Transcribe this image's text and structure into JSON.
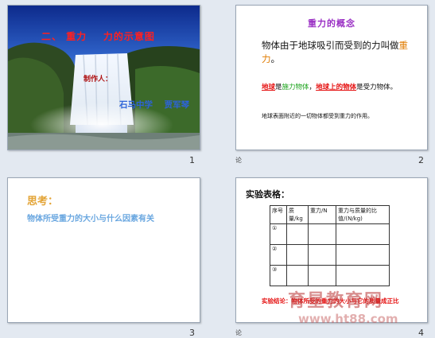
{
  "slides": [
    {
      "number": "1",
      "title": "二、 重力    力的示意图",
      "subtitle": "制作人：",
      "author": "石马中学    贾军琴"
    },
    {
      "number": "2",
      "title": "重力的概念",
      "definition_prefix": "物体由于地球吸引而受到的力叫做",
      "definition_highlight": "重力",
      "definition_suffix": "。",
      "relation_part1": "地球",
      "relation_part2": "是",
      "relation_part3": "施力物体",
      "relation_part4": "，",
      "relation_part5": "地球上的物体",
      "relation_part6": "是受力物体。",
      "note": "地球表面附近的一切物体都受到重力的作用。",
      "footer": "论"
    },
    {
      "number": "3",
      "think": "思考：",
      "question": "物体所受重力的大小与什么因素有关"
    },
    {
      "number": "4",
      "heading": "实验表格：",
      "table_headers": [
        "序号",
        "质量/kg",
        "重力/N",
        "重力与质量的比值/(N/kg)"
      ],
      "table_rows": [
        "①",
        "②",
        "③"
      ],
      "conclusion": "实验结论：物体所受的重力的大小与它的质量成正比",
      "footer": "论"
    }
  ],
  "watermark": "育星教育网",
  "watermark_url": "www.ht88.com",
  "colors": {
    "title_red": "#ff2020",
    "author_blue": "#2d63d8",
    "concept_purple": "#9a2fc4",
    "highlight_orange": "#e07b00",
    "think_gold": "#e3a436",
    "question_blue": "#6aa7e0",
    "conclusion_red": "#e51212"
  }
}
